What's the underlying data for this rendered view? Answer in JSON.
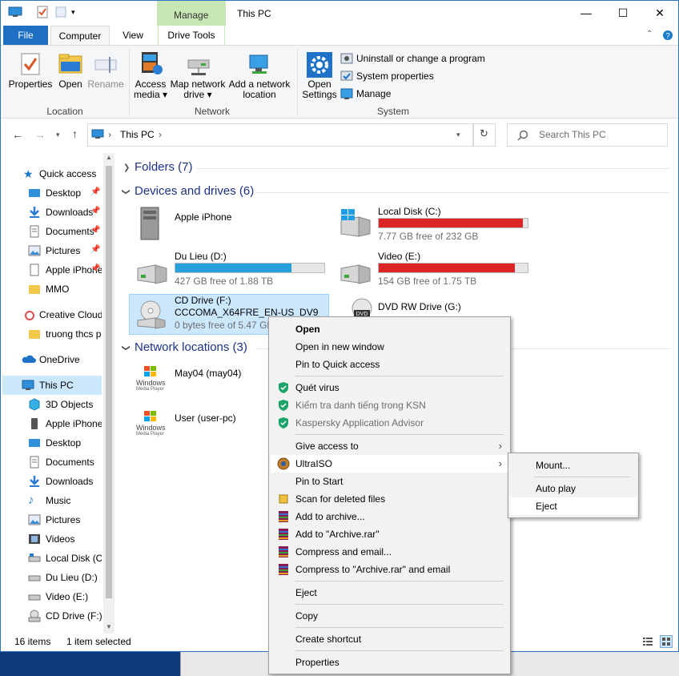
{
  "window": {
    "title": "This PC",
    "context_tab": "Manage",
    "minimize": "—",
    "maximize": "☐",
    "close": "✕"
  },
  "tabs": [
    "File",
    "Computer",
    "View",
    "Drive Tools"
  ],
  "ribbon": {
    "location": {
      "label": "Location",
      "properties": "Properties",
      "open": "Open",
      "rename": "Rename"
    },
    "network": {
      "label": "Network",
      "access_media": [
        "Access",
        "media ▾"
      ],
      "map_drive": [
        "Map network",
        "drive ▾"
      ],
      "add_location": [
        "Add a network",
        "location"
      ]
    },
    "system": {
      "label": "System",
      "open_settings": [
        "Open",
        "Settings"
      ],
      "uninstall": "Uninstall or change a program",
      "system_properties": "System properties",
      "manage": "Manage"
    }
  },
  "address": {
    "path_root": "›",
    "path": "This PC",
    "path_sep": "›",
    "search_placeholder": "Search This PC"
  },
  "nav": {
    "quick_access": "Quick access",
    "quick_items": [
      "Desktop",
      "Downloads",
      "Documents",
      "Pictures",
      "Apple iPhone",
      "MMO"
    ],
    "creative_cloud": "Creative Cloud Files",
    "truong": "truong thcs pho",
    "onedrive": "OneDrive",
    "this_pc": "This PC",
    "pc_items": [
      "3D Objects",
      "Apple iPhone",
      "Desktop",
      "Documents",
      "Downloads",
      "Music",
      "Pictures",
      "Videos",
      "Local Disk (C:)",
      "Du Lieu (D:)",
      "Video (E:)",
      "CD Drive (F:)"
    ]
  },
  "sections": {
    "folders": "Folders (7)",
    "devices": "Devices and drives (6)",
    "network": "Network locations (3)"
  },
  "drives": [
    {
      "name": "Apple iPhone"
    },
    {
      "name": "Local Disk (C:)",
      "free": "7.77 GB free of 232 GB",
      "used_fraction": 0.967,
      "bar_color": "#da2626"
    },
    {
      "name": "Du Lieu (D:)",
      "free": "427 GB free of 1.88 TB",
      "used_fraction": 0.778,
      "bar_color": "#26a0da"
    },
    {
      "name": "Video (E:)",
      "free": "154 GB free of 1.75 TB",
      "used_fraction": 0.914,
      "bar_color": "#da2626"
    },
    {
      "name": "CD Drive (F:)",
      "label": "CCCOMA_X64FRE_EN-US_DV9",
      "free": "0 bytes free of 5.47 GB"
    },
    {
      "name": "DVD RW Drive (G:)"
    }
  ],
  "network_locations": [
    {
      "name": "May04 (may04)",
      "logo": [
        "Windows",
        "Media Player"
      ]
    },
    {
      "name": "User (user-pc)",
      "logo": [
        "Windows",
        "Media Player"
      ]
    }
  ],
  "status": {
    "items": "16 items",
    "selected": "1 item selected"
  },
  "context_menu": {
    "open": "Open",
    "open_new": "Open in new window",
    "pin_quick": "Pin to Quick access",
    "scan_virus": "Quét virus",
    "check_rep": "Kiểm tra danh tiếng trong KSN",
    "kaspersky": "Kaspersky Application Advisor",
    "give_access": "Give access to",
    "ultraiso": "UltraISO",
    "pin_start": "Pin to Start",
    "scan_deleted": "Scan for deleted files",
    "add_archive": "Add to archive...",
    "add_rar": "Add to \"Archive.rar\"",
    "compress_email": "Compress and email...",
    "compress_rar_email": "Compress to \"Archive.rar\" and email",
    "eject": "Eject",
    "copy": "Copy",
    "create_shortcut": "Create shortcut",
    "properties": "Properties"
  },
  "submenu": {
    "mount": "Mount...",
    "auto_play": "Auto play",
    "eject": "Eject"
  },
  "colors": {
    "accent": "#1979ca",
    "manage_tab": "#c7e7b4",
    "selection": "#cce8ff",
    "file_tab": "#1f6fc5"
  }
}
